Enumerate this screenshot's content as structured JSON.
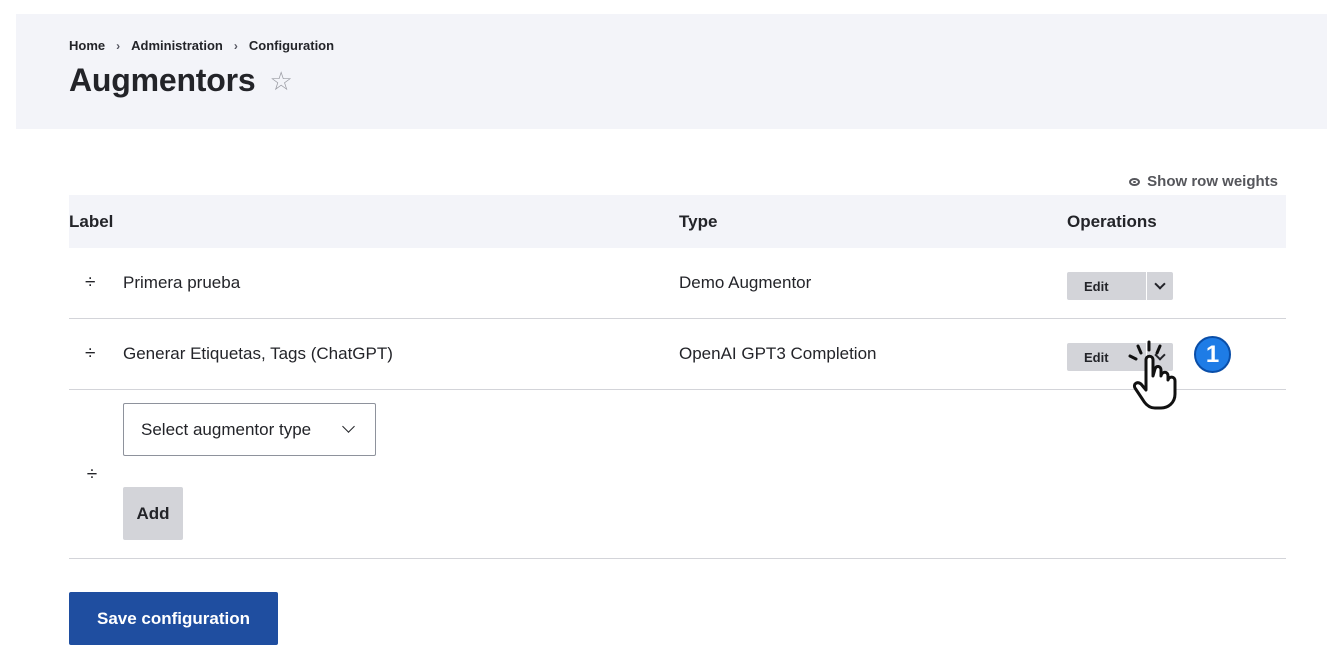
{
  "breadcrumb": [
    "Home",
    "Administration",
    "Configuration"
  ],
  "page_title": "Augmentors",
  "favorite_icon": "star-outline-icon",
  "show_row_weights": "Show row weights",
  "table": {
    "headers": {
      "label": "Label",
      "type": "Type",
      "operations": "Operations"
    },
    "rows": [
      {
        "label": "Primera prueba",
        "type": "Demo Augmentor",
        "edit": "Edit"
      },
      {
        "label": "Generar Etiquetas, Tags (ChatGPT)",
        "type": "OpenAI GPT3 Completion",
        "edit": "Edit"
      }
    ]
  },
  "new_row": {
    "select_value": "Select augmentor type",
    "add_label": "Add"
  },
  "save_label": "Save configuration",
  "step_badge": "1",
  "colors": {
    "header_bg": "#f3f4f9",
    "primary_button": "#1f4ea0",
    "badge": "#1e7ce6"
  }
}
